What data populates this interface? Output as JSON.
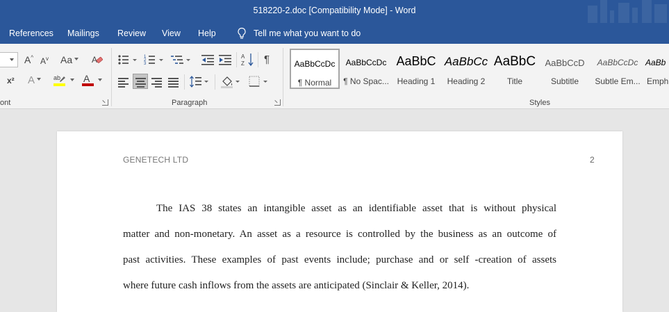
{
  "window": {
    "title": "518220-2.doc [Compatibility Mode]  -  Word"
  },
  "tabs": [
    "References",
    "Mailings",
    "Review",
    "View",
    "Help"
  ],
  "tell_me": {
    "text": "Tell me what you want to do",
    "icon": "lightbulb-icon"
  },
  "ribbon": {
    "font_group_label": "ont",
    "paragraph_group_label": "Paragraph",
    "styles_group_label": "Styles",
    "font_buttons": {
      "grow": "A",
      "shrink": "A",
      "case": "Aa",
      "superscript": "x²",
      "effects": "A",
      "font_color": "A"
    },
    "styles": [
      {
        "sample": "AaBbCcDc",
        "name": "¶ Normal"
      },
      {
        "sample": "AaBbCcDc",
        "name": "¶ No Spac..."
      },
      {
        "sample": "AaBbC",
        "name": "Heading 1"
      },
      {
        "sample": "AaBbCc",
        "name": "Heading 2"
      },
      {
        "sample": "AaBbC",
        "name": "Title"
      },
      {
        "sample": "AaBbCcD",
        "name": "Subtitle"
      },
      {
        "sample": "AaBbCcDc",
        "name": "Subtle Em..."
      },
      {
        "sample": "AaBb",
        "name": "Emph"
      }
    ]
  },
  "colors": {
    "accent": "#2b579a",
    "highlight": "#ffff00",
    "font_color": "#c00000"
  },
  "document": {
    "header_left": "GENETECH LTD",
    "page_number": "2",
    "lines": [
      "The IAS 38 states an intangible asset as an identifiable asset that is without physical",
      "matter and non-monetary. An asset as a resource is controlled by the business as an outcome of",
      "past activities. These examples of past events include; purchase and or self -creation of assets",
      "where future cash inflows from the assets are anticipated (Sinclair & Keller, 2014)."
    ]
  }
}
